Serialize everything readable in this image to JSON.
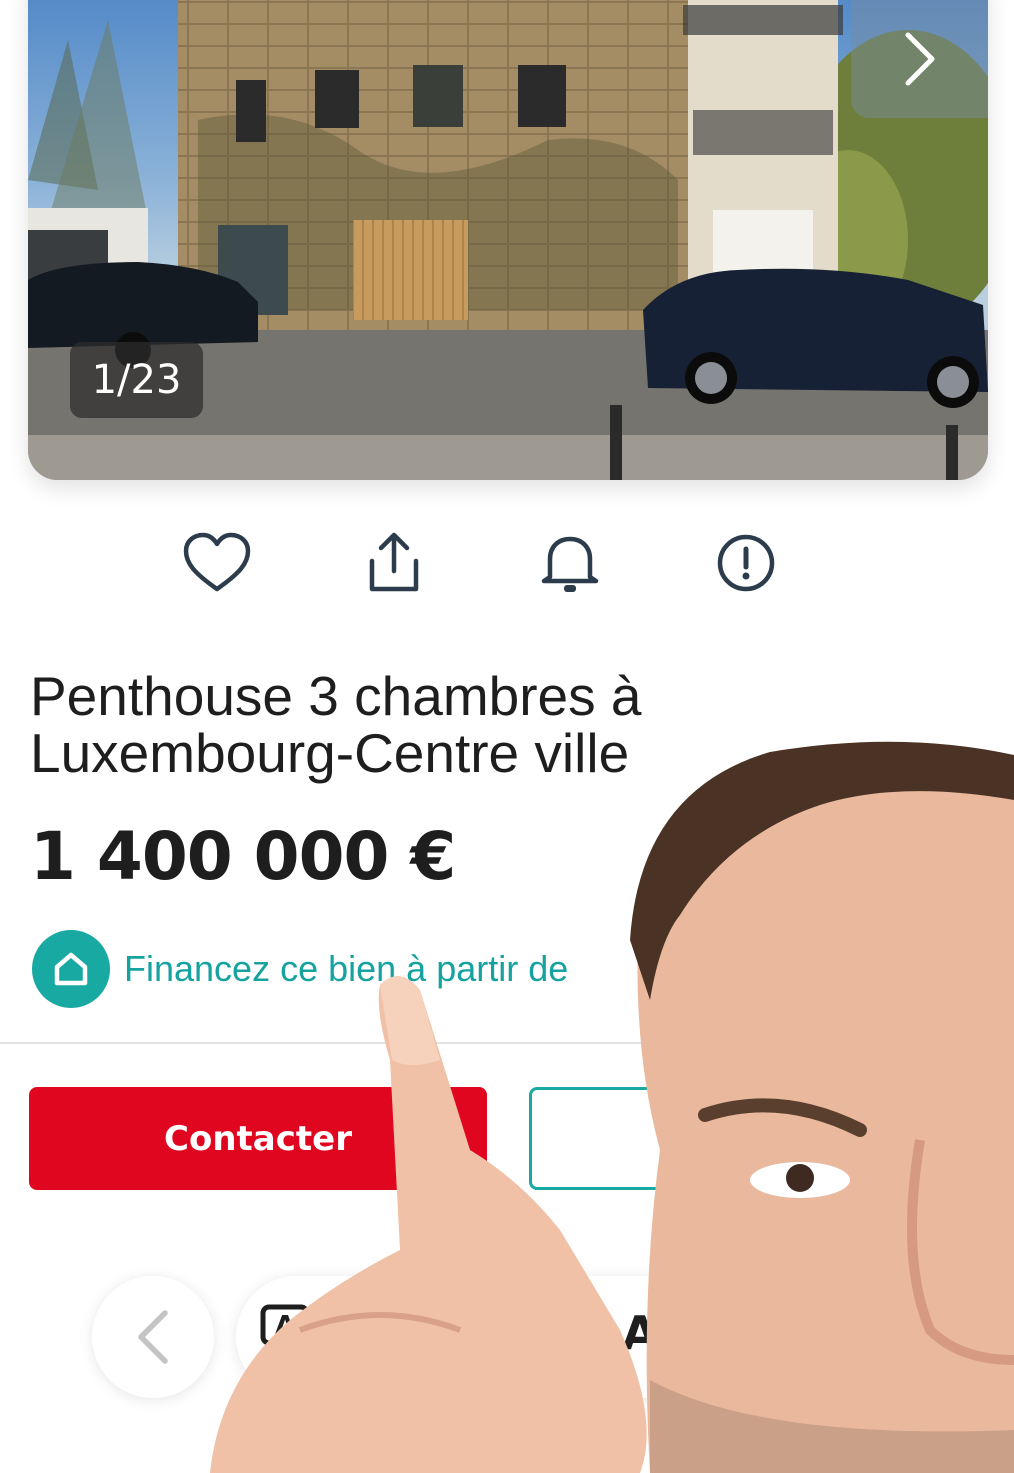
{
  "gallery": {
    "counter": "1/23",
    "next_icon": "chevron-right-icon"
  },
  "actions": [
    {
      "icon": "heart-icon",
      "label": "favorite"
    },
    {
      "icon": "share-icon",
      "label": "share"
    },
    {
      "icon": "bell-icon",
      "label": "alert"
    },
    {
      "icon": "report-icon",
      "label": "report"
    }
  ],
  "listing": {
    "title": "Penthouse 3 chambres à Luxembourg-Centre ville",
    "price": "1 400 000 €",
    "finance_text": "Financez ce bien à partir de"
  },
  "buttons": {
    "contact": "Contacter"
  },
  "bottom_nav": {
    "letter": "A"
  },
  "colors": {
    "brand_red": "#e1061f",
    "brand_teal": "#18a9a3",
    "text": "#1e1e1e"
  }
}
